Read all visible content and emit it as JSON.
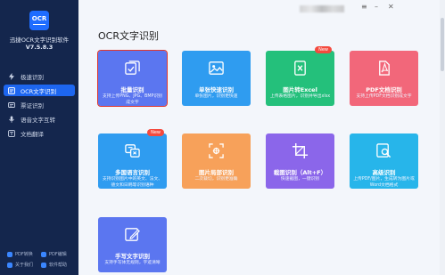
{
  "app": {
    "logo_text": "OCR",
    "name": "迅捷OCR文字识别软件",
    "version": "V7.5.8.3"
  },
  "window_controls": {
    "menu": "≡",
    "minimize": "–",
    "close": "✕"
  },
  "sidebar": {
    "items": [
      {
        "label": "极速识别",
        "icon": "lightning-icon",
        "active": false
      },
      {
        "label": "OCR文字识别",
        "icon": "ocr-icon",
        "active": true
      },
      {
        "label": "票证识别",
        "icon": "ticket-icon",
        "active": false
      },
      {
        "label": "语音文字互转",
        "icon": "microphone-icon",
        "active": false
      },
      {
        "label": "文档翻译",
        "icon": "translate-icon",
        "active": false
      }
    ],
    "footer": [
      {
        "label": "PDF转换"
      },
      {
        "label": "PDF编辑"
      },
      {
        "label": "关于我们"
      },
      {
        "label": "软件帮助"
      }
    ]
  },
  "main": {
    "section_title": "OCR文字识别",
    "cards": [
      {
        "name": "批量识别",
        "desc": "支持上传PNG、JPG、BMP识别成文字",
        "color": "#5b76f0",
        "icon": "batch-scan-icon",
        "selected": true,
        "badge": ""
      },
      {
        "name": "单张快速识别",
        "desc": "单张图片，识别更快速",
        "color": "#2f9cf0",
        "icon": "image-icon",
        "selected": false,
        "badge": ""
      },
      {
        "name": "图片转Excel",
        "desc": "上传表格图片，识别并导出xlsx",
        "color": "#24c07b",
        "icon": "excel-icon",
        "selected": false,
        "badge": "New"
      },
      {
        "name": "PDF文档识别",
        "desc": "支持上传PDF文档识别成文字",
        "color": "#f2677a",
        "icon": "pdf-icon",
        "selected": false,
        "badge": ""
      },
      {
        "name": "多国语言识别",
        "desc": "支持识别图片中的英文、法文、德文和日韩等识别语种",
        "color": "#2f9cf0",
        "icon": "language-icon",
        "selected": false,
        "badge": "New"
      },
      {
        "name": "图片局部识别",
        "desc": "二次裁切，识别更准确",
        "color": "#f7a15a",
        "icon": "crop-scan-icon",
        "selected": false,
        "badge": ""
      },
      {
        "name": "截图识别（Alt+F）",
        "desc": "快速截图，一键识别",
        "color": "#8b66ea",
        "icon": "screenshot-icon",
        "selected": false,
        "badge": ""
      },
      {
        "name": "高级识别",
        "desc": "上传PDF/图片，生成转为图片或Word文档格式",
        "color": "#27b5ea",
        "icon": "advanced-search-icon",
        "selected": false,
        "badge": ""
      },
      {
        "name": "手写文字识别",
        "desc": "支持手写体无规则，字迹清晰",
        "color": "#5b76f0",
        "icon": "handwriting-icon",
        "selected": false,
        "badge": ""
      }
    ]
  }
}
